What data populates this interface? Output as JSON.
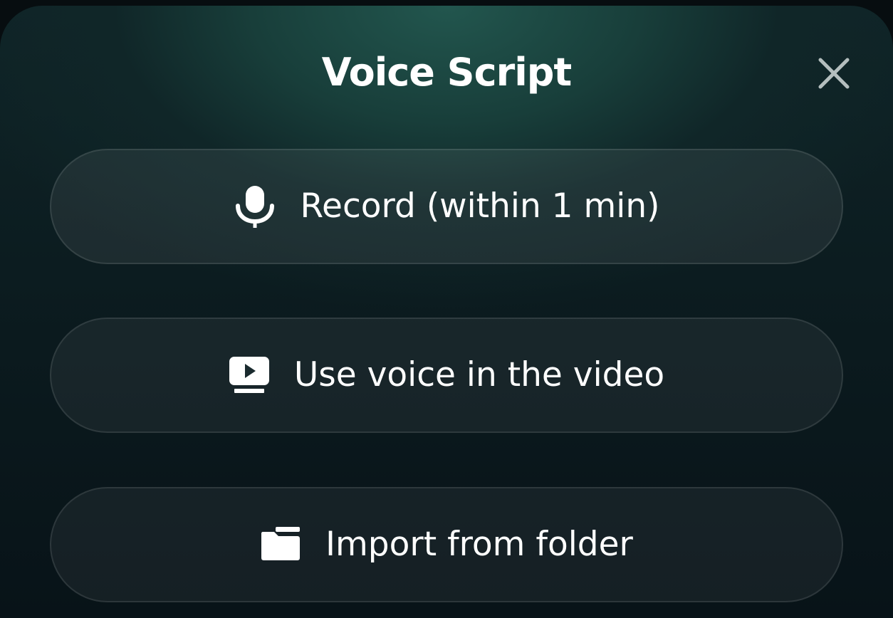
{
  "dialog": {
    "title": "Voice Script",
    "close_icon": "close-icon"
  },
  "options": [
    {
      "label": "Record (within 1 min)",
      "icon": "microphone-icon"
    },
    {
      "label": "Use voice in the video",
      "icon": "video-play-icon"
    },
    {
      "label": "Import from folder",
      "icon": "folder-icon"
    }
  ],
  "colors": {
    "background": "#0b1a1e",
    "accent_glow": "#22564e",
    "text": "#ffffff",
    "close_icon": "#b4bebe"
  }
}
